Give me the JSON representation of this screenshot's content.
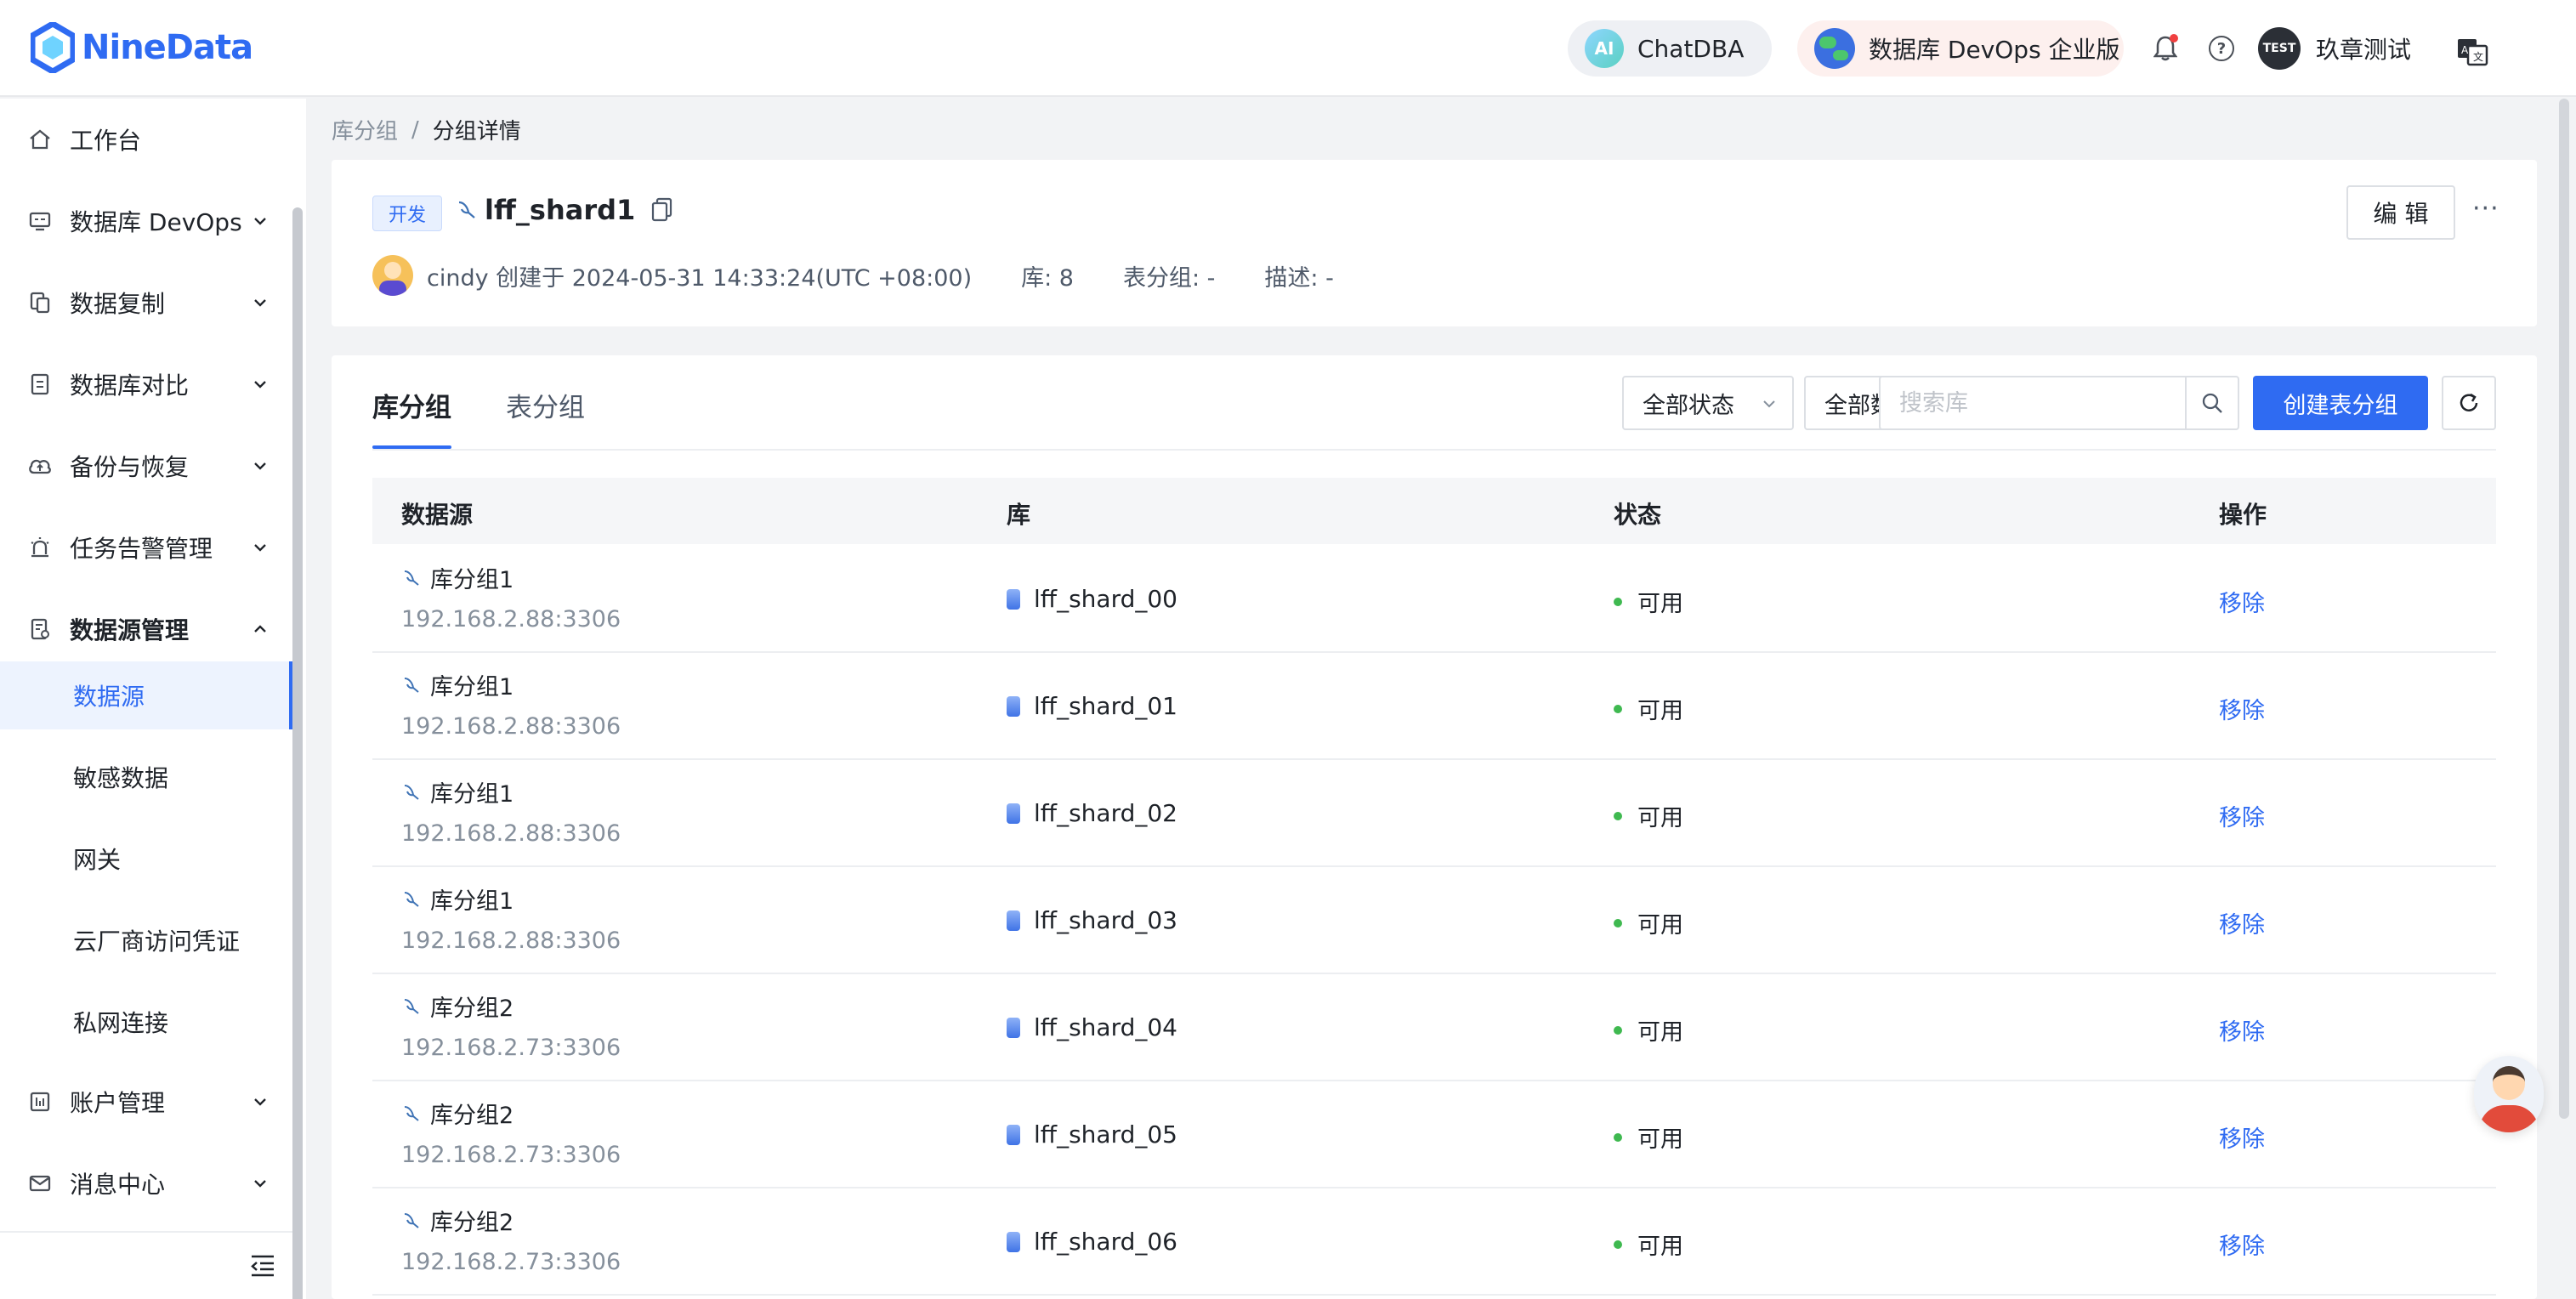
{
  "header": {
    "logo_text": "NineData",
    "chatdba_badge": "AI",
    "chatdba_label": "ChatDBA",
    "devops_label": "数据库 DevOps 企业版",
    "user_badge": "TEST",
    "user_name": "玖章测试",
    "icons": [
      "bell-icon",
      "help-icon",
      "translate-icon"
    ]
  },
  "sidebar": {
    "items": [
      {
        "label": "工作台",
        "icon": "home-icon",
        "expandable": false
      },
      {
        "label": "数据库 DevOps",
        "icon": "devops-icon",
        "expandable": true
      },
      {
        "label": "数据复制",
        "icon": "replication-icon",
        "expandable": true
      },
      {
        "label": "数据库对比",
        "icon": "compare-icon",
        "expandable": true
      },
      {
        "label": "备份与恢复",
        "icon": "backup-icon",
        "expandable": true
      },
      {
        "label": "任务告警管理",
        "icon": "alarm-icon",
        "expandable": true
      },
      {
        "label": "数据源管理",
        "icon": "datasource-icon",
        "expandable": true,
        "expanded": true
      },
      {
        "label": "账户管理",
        "icon": "account-icon",
        "expandable": true
      },
      {
        "label": "消息中心",
        "icon": "message-icon",
        "expandable": true
      }
    ],
    "subitems": [
      {
        "label": "数据源",
        "active": true
      },
      {
        "label": "敏感数据",
        "active": false
      },
      {
        "label": "网关",
        "active": false
      },
      {
        "label": "云厂商访问凭证",
        "active": false
      },
      {
        "label": "私网连接",
        "active": false
      }
    ]
  },
  "breadcrumb": {
    "parent": "库分组",
    "separator": "/",
    "current": "分组详情"
  },
  "group": {
    "env_tag": "开发",
    "name": "lff_shard1",
    "creator": "cindy 创建于 2024-05-31 14:33:24(UTC +08:00)",
    "db_count": "库: 8",
    "table_group": "表分组: -",
    "description": "描述: -",
    "edit_label": "编 辑",
    "more_label": "···"
  },
  "tabs": [
    {
      "label": "库分组",
      "active": true
    },
    {
      "label": "表分组",
      "active": false
    }
  ],
  "filters": {
    "status_select": "全部状态",
    "datasource_select": "全部数据源",
    "search_placeholder": "搜索库",
    "create_label": "创建表分组"
  },
  "table": {
    "columns": [
      "数据源",
      "库",
      "状态",
      "操作"
    ],
    "rows": [
      {
        "source": "库分组1",
        "address": "192.168.2.88:3306",
        "database": "lff_shard_00",
        "status": "可用",
        "action": "移除"
      },
      {
        "source": "库分组1",
        "address": "192.168.2.88:3306",
        "database": "lff_shard_01",
        "status": "可用",
        "action": "移除"
      },
      {
        "source": "库分组1",
        "address": "192.168.2.88:3306",
        "database": "lff_shard_02",
        "status": "可用",
        "action": "移除"
      },
      {
        "source": "库分组1",
        "address": "192.168.2.88:3306",
        "database": "lff_shard_03",
        "status": "可用",
        "action": "移除"
      },
      {
        "source": "库分组2",
        "address": "192.168.2.73:3306",
        "database": "lff_shard_04",
        "status": "可用",
        "action": "移除"
      },
      {
        "source": "库分组2",
        "address": "192.168.2.73:3306",
        "database": "lff_shard_05",
        "status": "可用",
        "action": "移除"
      },
      {
        "source": "库分组2",
        "address": "192.168.2.73:3306",
        "database": "lff_shard_06",
        "status": "可用",
        "action": "移除"
      }
    ]
  },
  "colors": {
    "accent": "#2f6bf2",
    "status_ok": "#3fb950",
    "text_muted": "#86909c"
  }
}
